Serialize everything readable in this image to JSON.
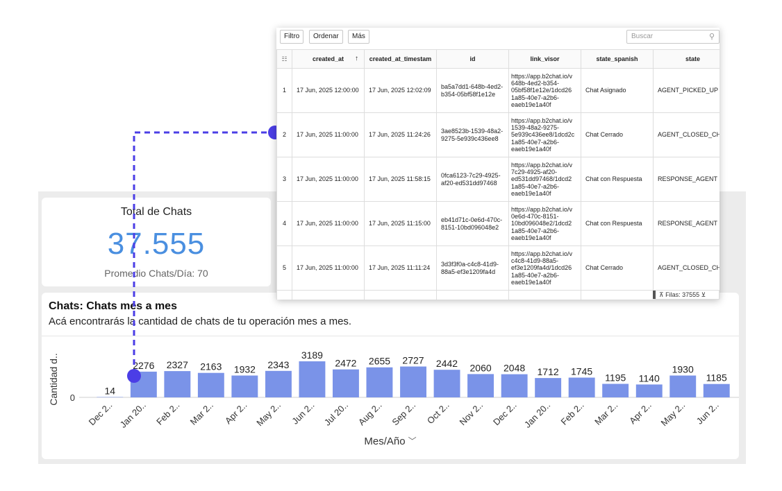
{
  "total_card": {
    "title": "Total de Chats",
    "value": "37.555",
    "subtitle": "Promedio Chats/Día: 70"
  },
  "chart_card": {
    "title": "Chats: Chats mes a mes",
    "description": "Acá encontrarás la cantidad de chats de tu operación mes a mes.",
    "x_axis_title": "Mes/Año",
    "x_axis_dropdown_icon": "chevron-down-icon"
  },
  "chart_data": {
    "type": "bar",
    "categories": [
      "Dec 2..",
      "Jan 20..",
      "Feb 2..",
      "Mar 2..",
      "Apr 2..",
      "May 2..",
      "Jun 2..",
      "Jul 20..",
      "Aug 2..",
      "Sep 2..",
      "Oct 2..",
      "Nov 2..",
      "Dec 2..",
      "Jan 20..",
      "Feb 2..",
      "Mar 2..",
      "Apr 2..",
      "May 2..",
      "Jun 2.."
    ],
    "values": [
      14,
      2276,
      2327,
      2163,
      1932,
      2343,
      3189,
      2472,
      2655,
      2727,
      2442,
      2060,
      2048,
      1712,
      1745,
      1195,
      1140,
      1930,
      1185
    ],
    "ylabel": "Cantidad d..",
    "xlabel": "Mes/Año",
    "y_ticks": [
      "0"
    ],
    "ylim": [
      0,
      3189
    ],
    "bar_color": "#7a93e8",
    "data_labels": true
  },
  "table": {
    "toolbar": {
      "filter_label": "Filtro",
      "sort_label": "Ordenar",
      "more_label": "Más",
      "search_placeholder": "Buscar"
    },
    "columns": [
      "created_at",
      "created_at_timestamp",
      "id",
      "link_visor",
      "state_spanish",
      "state"
    ],
    "header_visible": [
      "created_at",
      "created_at_timestam",
      "id",
      "link_visor",
      "state_spanish",
      "state"
    ],
    "rows": [
      {
        "n": "1",
        "created_at": "17 Jun, 2025 12:00:00",
        "created_at_timestamp": "17 Jun, 2025 12:02:09",
        "id": "ba5a7dd1-648b-4ed2-b354-05bf58f1e12e",
        "link_visor": "https://app.b2chat.io/v 648b-4ed2-b354-05bf58f1e12e/1dcd26 1a85-40e7-a2b6-eaeb19e1a40f",
        "state_spanish": "Chat Asignado",
        "state": "AGENT_PICKED_UP"
      },
      {
        "n": "2",
        "created_at": "17 Jun, 2025 11:00:00",
        "created_at_timestamp": "17 Jun, 2025 11:24:26",
        "id": "3ae8523b-1539-48a2-9275-5e939c436ee8",
        "link_visor": "https://app.b2chat.io/v 1539-48a2-9275-5e939c436ee8/1dcd2c 1a85-40e7-a2b6-eaeb19e1a40f",
        "state_spanish": "Chat Cerrado",
        "state": "AGENT_CLOSED_CH"
      },
      {
        "n": "3",
        "created_at": "17 Jun, 2025 11:00:00",
        "created_at_timestamp": "17 Jun, 2025 11:58:15",
        "id": "0fca6123-7c29-4925-af20-ed531dd97468",
        "link_visor": "https://app.b2chat.io/v 7c29-4925-af20-ed531dd97468/1dcd2 1a85-40e7-a2b6-eaeb19e1a40f",
        "state_spanish": "Chat con Respuesta",
        "state": "RESPONSE_AGENT"
      },
      {
        "n": "4",
        "created_at": "17 Jun, 2025 11:00:00",
        "created_at_timestamp": "17 Jun, 2025 11:15:00",
        "id": "eb41d71c-0e6d-470c-8151-10bd096048e2",
        "link_visor": "https://app.b2chat.io/v 0e6d-470c-8151-10bd096048e2/1dcd2 1a85-40e7-a2b6-eaeb19e1a40f",
        "state_spanish": "Chat con Respuesta",
        "state": "RESPONSE_AGENT"
      },
      {
        "n": "5",
        "created_at": "17 Jun, 2025 11:00:00",
        "created_at_timestamp": "17 Jun, 2025 11:11:24",
        "id": "3d3f3f0a-c4c8-41d9-88a5-ef3e1209fa4d",
        "link_visor": "https://app.b2chat.io/v c4c8-41d9-88a5-ef3e1209fa4d/1dcd26 1a85-40e7-a2b6-eaeb19e1a40f",
        "state_spanish": "Chat Cerrado",
        "state": "AGENT_CLOSED_CH"
      },
      {
        "n": "",
        "created_at": "",
        "created_at_timestamp": "",
        "id": "6cfafbd9-ae28-",
        "link_visor": "https://app.b2chat.io/v ae28-4303-8ee6-",
        "state_spanish": "",
        "state": ""
      }
    ],
    "footer": {
      "rows_label": "Filas: 37555"
    }
  },
  "colors": {
    "accent_value": "#4a8fe0",
    "bar": "#7a93e8",
    "connector": "#4b3ee6",
    "dashboard_bg": "#ececec"
  }
}
